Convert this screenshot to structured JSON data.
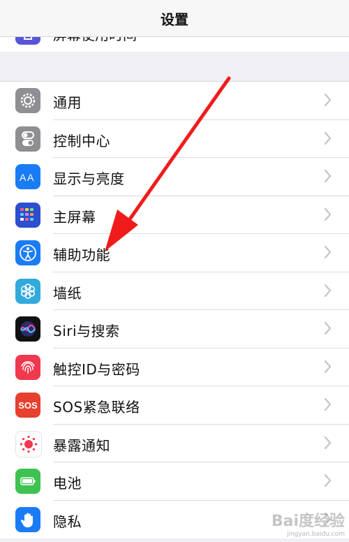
{
  "header": {
    "title": "设置"
  },
  "partial_item": {
    "label": "屏幕使用时间",
    "icon": "hourglass-icon"
  },
  "items": [
    {
      "label": "通用",
      "icon": "gear-icon",
      "color": "#8e8e93"
    },
    {
      "label": "控制中心",
      "icon": "toggles-icon",
      "color": "#8e8e93"
    },
    {
      "label": "显示与亮度",
      "icon": "text-size-icon",
      "color": "#1a7cf5"
    },
    {
      "label": "主屏幕",
      "icon": "app-grid-icon",
      "color": "#2b4fcf"
    },
    {
      "label": "辅助功能",
      "icon": "accessibility-icon",
      "color": "#1a7cf5"
    },
    {
      "label": "墙纸",
      "icon": "flower-icon",
      "color": "#33aadc"
    },
    {
      "label": "Siri与搜索",
      "icon": "siri-icon",
      "color": "#111111"
    },
    {
      "label": "触控ID与密码",
      "icon": "fingerprint-icon",
      "color": "#f0384f"
    },
    {
      "label": "SOS紧急联络",
      "icon": "sos-icon",
      "color": "#e8402f",
      "icon_text": "SOS"
    },
    {
      "label": "暴露通知",
      "icon": "exposure-icon",
      "color": "#ffffff"
    },
    {
      "label": "电池",
      "icon": "battery-icon",
      "color": "#3ec251"
    },
    {
      "label": "隐私",
      "icon": "hand-icon",
      "color": "#1a7cf5"
    }
  ],
  "annotation": {
    "type": "red-arrow",
    "points_to": "辅助功能"
  },
  "watermark": {
    "text": "Bai度经验",
    "subtext": "jingyan.baidu.com"
  }
}
